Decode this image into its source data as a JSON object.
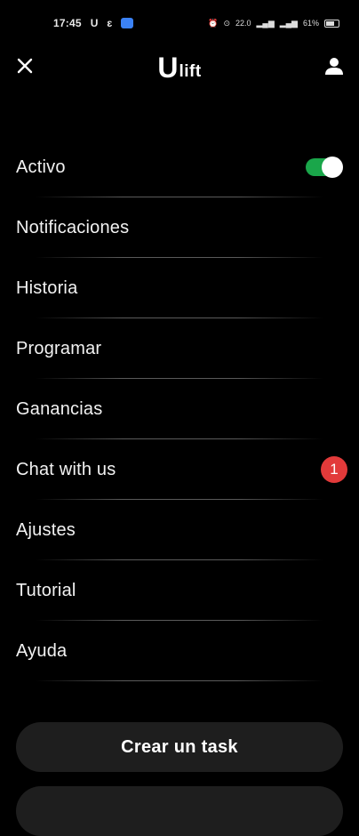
{
  "status_bar": {
    "time": "17:45",
    "app_icon_1": "U",
    "app_icon_2": "ɛ",
    "speed": "22.0",
    "battery_text": "61%"
  },
  "header": {
    "logo_big": "U",
    "logo_small": "lift",
    "close_icon": "close-icon",
    "profile_icon": "person-icon"
  },
  "menu": {
    "items": [
      {
        "label": "Activo",
        "control": "toggle",
        "toggle_on": true
      },
      {
        "label": "Notificaciones"
      },
      {
        "label": "Historia"
      },
      {
        "label": "Programar"
      },
      {
        "label": "Ganancias"
      },
      {
        "label": "Chat with us",
        "badge": "1"
      },
      {
        "label": "Ajustes"
      },
      {
        "label": "Tutorial"
      },
      {
        "label": "Ayuda"
      }
    ]
  },
  "actions": {
    "primary_label": "Crear un task"
  },
  "colors": {
    "background": "#000000",
    "toggle_on": "#1aa64a",
    "badge": "#e23a3a",
    "button_bg": "#1e1e1e"
  }
}
